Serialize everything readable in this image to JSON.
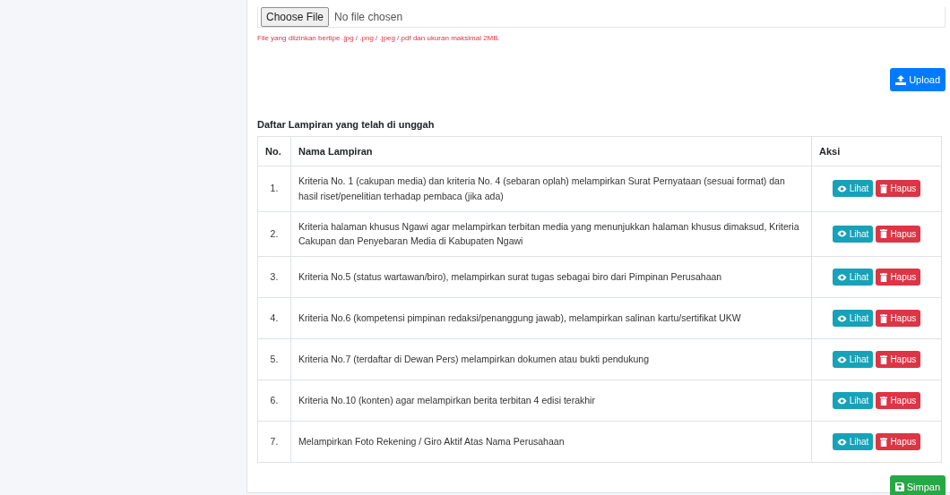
{
  "file_input": {
    "button": "Choose File",
    "value": "No file chosen"
  },
  "file_hint": "File yang diizinkan bertipe .jpg / .png / .jpeg /.pdf dan ukuran maksimal 2MB.",
  "upload_button": "Upload",
  "list_title": "Daftar Lampiran yang telah di unggah",
  "table": {
    "columns": [
      "No.",
      "Nama Lampiran",
      "Aksi"
    ],
    "rows": [
      {
        "no": "1.",
        "name": "Kriteria No. 1 (cakupan media) dan kriteria No. 4 (sebaran oplah) melampirkan Surat Pernyataan (sesuai format) dan hasil riset/penelitian terhadap pembaca (jika ada)",
        "view": "Lihat",
        "delete": "Hapus"
      },
      {
        "no": "2.",
        "name": "Kriteria halaman khusus Ngawi agar melampirkan terbitan media yang menunjukkan halaman khusus dimaksud, Kriteria Cakupan dan Penyebaran Media di Kabupaten Ngawi",
        "view": "Lihat",
        "delete": "Hapus"
      },
      {
        "no": "3.",
        "name": "Kriteria No.5 (status wartawan/biro), melampirkan surat tugas sebagai biro dari Pimpinan Perusahaan",
        "view": "Lihat",
        "delete": "Hapus"
      },
      {
        "no": "4.",
        "name": "Kriteria No.6 (kompetensi pimpinan redaksi/penanggung jawab), melampirkan salinan kartu/sertifikat UKW",
        "view": "Lihat",
        "delete": "Hapus"
      },
      {
        "no": "5.",
        "name": "Kriteria No.7 (terdaftar di Dewan Pers) melampirkan dokumen atau bukti pendukung",
        "view": "Lihat",
        "delete": "Hapus"
      },
      {
        "no": "6.",
        "name": "Kriteria No.10 (konten) agar melampirkan berita terbitan 4 edisi terakhir",
        "view": "Lihat",
        "delete": "Hapus"
      },
      {
        "no": "7.",
        "name": "Melampirkan Foto Rekening / Giro Aktif Atas Nama Perusahaan",
        "view": "Lihat",
        "delete": "Hapus"
      }
    ]
  },
  "save_button": "Simpan"
}
